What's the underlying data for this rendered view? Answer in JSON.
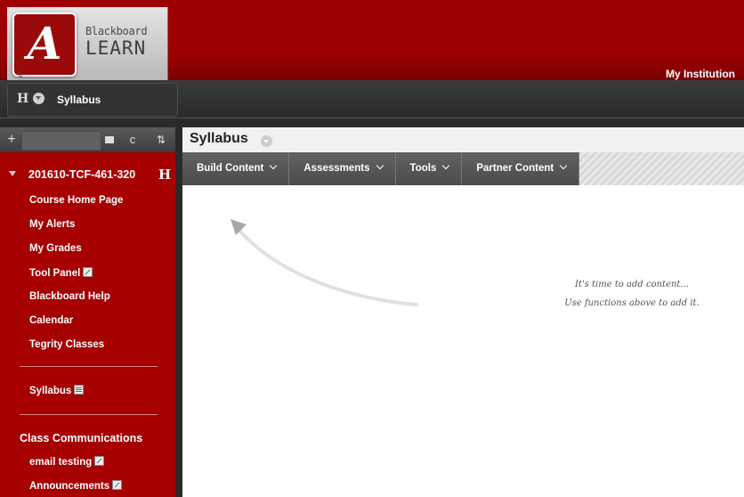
{
  "header": {
    "brand_small": "Blackboard",
    "brand_large": "LEARN",
    "logo_letter": "A",
    "institution_link": "My Institution"
  },
  "breadcrumb": {
    "course_initial": "H",
    "current_page": "Syllabus"
  },
  "sidebar": {
    "toolbar": {
      "add": "+",
      "refresh": "c",
      "sort": "⇅"
    },
    "course_title": "201610-TCF-461-320",
    "course_initial": "H",
    "items": [
      {
        "label": "Course Home Page"
      },
      {
        "label": "My Alerts"
      },
      {
        "label": "My Grades"
      },
      {
        "label": "Tool Panel"
      },
      {
        "label": "Blackboard Help"
      },
      {
        "label": "Calendar"
      },
      {
        "label": "Tegrity Classes"
      }
    ],
    "syllabus_item": "Syllabus",
    "section_header": "Class Communications",
    "section_items": [
      {
        "label": "email testing"
      },
      {
        "label": "Announcements"
      }
    ]
  },
  "content": {
    "page_title": "Syllabus",
    "action_menus": [
      {
        "label": "Build Content"
      },
      {
        "label": "Assessments"
      },
      {
        "label": "Tools"
      },
      {
        "label": "Partner Content"
      }
    ],
    "empty_line1": "It's time to add content...",
    "empty_line2": "Use functions above to add it."
  },
  "colors": {
    "brand_red": "#a60000",
    "header_red": "#9e0000",
    "toolbar_gray": "#555555"
  }
}
